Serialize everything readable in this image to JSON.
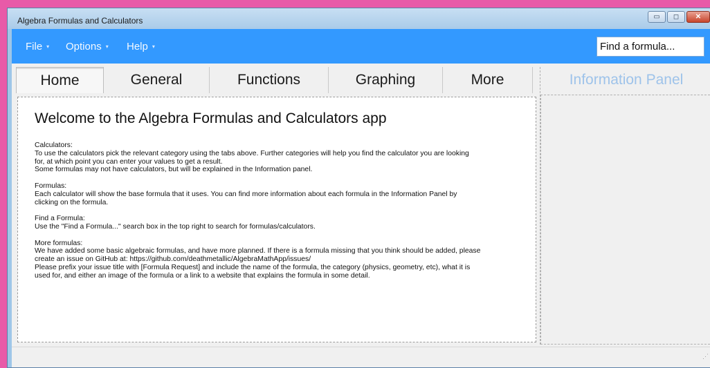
{
  "window": {
    "title": "Algebra Formulas and Calculators",
    "minimize_glyph": "▭",
    "maximize_glyph": "◻",
    "close_glyph": "✕"
  },
  "menu": {
    "items": [
      {
        "label": "File",
        "caret": "▾"
      },
      {
        "label": "Options",
        "caret": "▾"
      },
      {
        "label": "Help",
        "caret": "▾"
      }
    ]
  },
  "search": {
    "placeholder": "Find a formula..."
  },
  "tabs": [
    {
      "label": "Home",
      "active": true
    },
    {
      "label": "General",
      "active": false
    },
    {
      "label": "Functions",
      "active": false
    },
    {
      "label": "Graphing",
      "active": false
    },
    {
      "label": "More",
      "active": false
    }
  ],
  "home": {
    "heading": "Welcome to the Algebra Formulas and Calculators app",
    "sections": [
      {
        "lines": [
          "Calculators:",
          "To use the calculators pick the relevant category using the tabs above. Further categories will help you find the calculator you are looking",
          "for, at which point you can enter your values to get a result.",
          "Some formulas may not have calculators, but will be explained in the Information panel."
        ]
      },
      {
        "lines": [
          "Formulas:",
          "Each calculator will show the base formula that it uses. You can find more information about each formula in the Information Panel by",
          "clicking on the formula."
        ]
      },
      {
        "lines": [
          "Find a Formula:",
          "Use the \"Find a Formula...\" search box in the top right to search for formulas/calculators."
        ]
      },
      {
        "lines": [
          "More formulas:",
          "We have added some basic algebraic formulas, and have more planned. If there is a formula missing that you think should be added, please",
          "create an issue on GitHub at: https://github.com/deathmetallic/AlgebraMathApp/issues/",
          "Please prefix your issue title with [Formula Request] and include the name of the formula, the category (physics, geometry, etc), what it is",
          "used for, and either an image of the formula or a link to a website that explains the formula in some detail."
        ]
      }
    ]
  },
  "info_panel": {
    "title": "Information Panel"
  },
  "colors": {
    "menubar": "#3399ff",
    "info_title": "#9ec3ea",
    "frame": "#e85aa8"
  },
  "icons": {
    "resize_grip": "resize-grip-icon",
    "resize_grip_glyph": "⋰"
  }
}
